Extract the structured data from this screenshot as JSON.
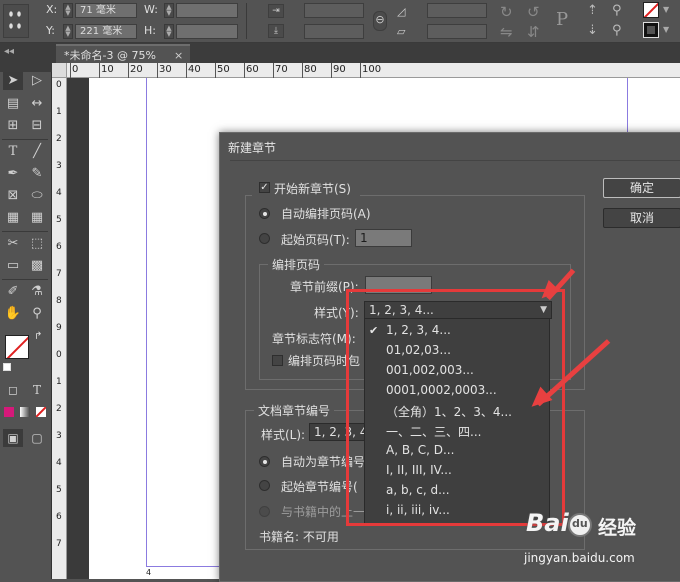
{
  "control_bar": {
    "x_label": "X:",
    "x_value": "71 毫米",
    "y_label": "Y:",
    "y_value": "221 毫米",
    "w_label": "W:",
    "h_label": "H:"
  },
  "tab": {
    "title": "*未命名-3 @ 75%",
    "close": "×"
  },
  "ruler": {
    "ticks": [
      "0",
      "10",
      "20",
      "30",
      "40",
      "50",
      "60",
      "70",
      "80",
      "90",
      "100"
    ],
    "vticks": [
      "0",
      "1",
      "2",
      "3",
      "4",
      "5",
      "6",
      "7",
      "8",
      "9",
      "0",
      "1",
      "2",
      "3",
      "4",
      "5",
      "6",
      "7"
    ]
  },
  "toolbox": {
    "type_tool": "T",
    "text_wrap": "T"
  },
  "dialog": {
    "title": "新建章节",
    "start_section_label": "开始新章节(S)",
    "auto_number_label": "自动编排页码(A)",
    "start_page_label": "起始页码(T):",
    "start_page_value": "1",
    "page_numbering_group": "编排页码",
    "section_prefix_label": "章节前缀(P):",
    "style_label": "样式(Y):",
    "style_value": "1, 2, 3, 4...",
    "section_marker_label": "章节标志符(M):",
    "include_prefix_label": "编排页码时包",
    "doc_chapter_group": "文档章节编号",
    "doc_style_label": "样式(L):",
    "doc_style_value": "1, 2, 3, 4",
    "auto_chapter_label": "自动为章节编号",
    "start_chapter_label": "起始章节编号(",
    "same_as_book_label": "与书籍中的上一",
    "book_name_label": "书籍名: 不可用",
    "ok_button": "确定",
    "cancel_button": "取消"
  },
  "dropdown": {
    "options": [
      "1, 2, 3, 4...",
      "01,02,03...",
      "001,002,003...",
      "0001,0002,0003...",
      "（全角）1、2、3、4...",
      "一、二、三、四...",
      "A, B, C, D...",
      "I, II, III, IV...",
      "a, b, c, d...",
      "i, ii, iii, iv..."
    ],
    "checked_index": 0
  },
  "watermark": {
    "brand": "Bai",
    "paw": "du",
    "cn": "经验",
    "url": "jingyan.baidu.com"
  },
  "colors": {
    "annotation_red": "#e53a3a",
    "guide": "#8b7be0"
  }
}
